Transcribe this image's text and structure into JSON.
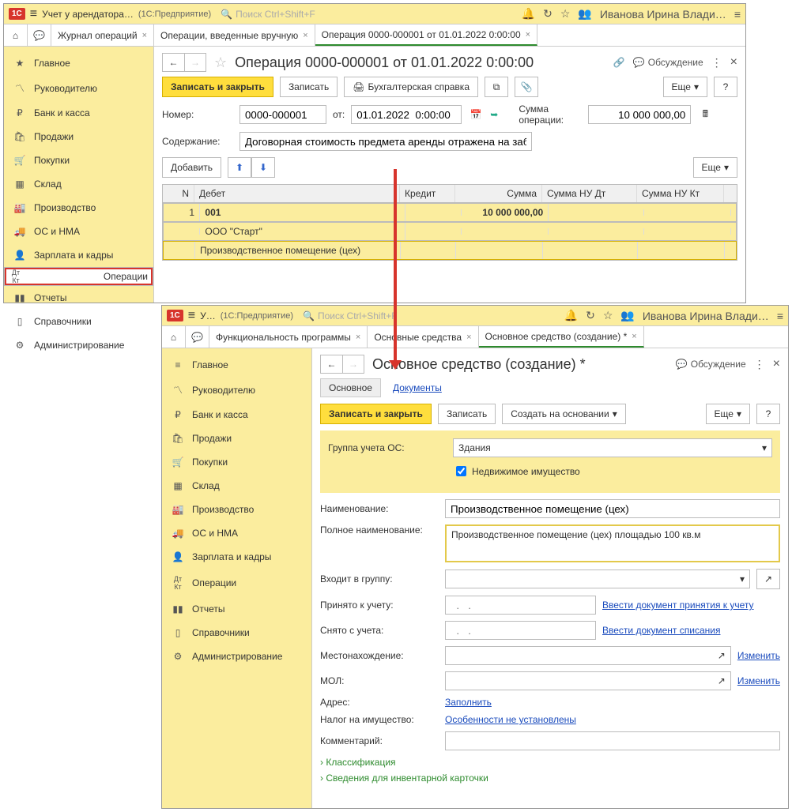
{
  "w1": {
    "title": "Учет у арендатора…",
    "subtitle": "(1С:Предприятие)",
    "search_ph": "Поиск Ctrl+Shift+F",
    "user": "Иванова Ирина Владимиров…",
    "tabs": [
      "Журнал операций",
      "Операции, введенные вручную",
      "Операция 0000-000001 от 01.01.2022 0:00:00"
    ],
    "sidebar": [
      "Главное",
      "Руководителю",
      "Банк и касса",
      "Продажи",
      "Покупки",
      "Склад",
      "Производство",
      "ОС и НМА",
      "Зарплата и кадры",
      "Операции",
      "Отчеты",
      "Справочники",
      "Администрирование"
    ],
    "page": {
      "title": "Операция 0000-000001 от 01.01.2022 0:00:00",
      "discuss": "Обсуждение",
      "save_close": "Записать и закрыть",
      "save": "Записать",
      "print": "Бухгалтерская справка",
      "more": "Еще",
      "num_lbl": "Номер:",
      "num": "0000-000001",
      "from_lbl": "от:",
      "from": "01.01.2022  0:00:00",
      "sum_lbl": "Сумма операции:",
      "sum": "10 000 000,00",
      "content_lbl": "Содержание:",
      "content": "Договорная стоимость предмета аренды отражена на заб",
      "add": "Добавить",
      "cols": {
        "n": "N",
        "db": "Дебет",
        "kr": "Кредит",
        "sm": "Сумма",
        "dt": "Сумма НУ Дт",
        "kt": "Сумма НУ Кт"
      },
      "row": {
        "n": "1",
        "db": "001",
        "r2": "ООО \"Старт\"",
        "r3": "Производственное помещение (цех)",
        "sm": "10 000 000,00"
      }
    }
  },
  "w2": {
    "title": "У…",
    "subtitle": "(1С:Предприятие)",
    "search_ph": "Поиск Ctrl+Shift+F",
    "user": "Иванова Ирина Владимир…",
    "tabs": [
      "Функциональность программы",
      "Основные средства",
      "Основное средство (создание) *"
    ],
    "sidebar": [
      "Главное",
      "Руководителю",
      "Банк и касса",
      "Продажи",
      "Покупки",
      "Склад",
      "Производство",
      "ОС и НМА",
      "Зарплата и кадры",
      "Операции",
      "Отчеты",
      "Справочники",
      "Администрирование"
    ],
    "page": {
      "title": "Основное средство (создание) *",
      "discuss": "Обсуждение",
      "sub_main": "Основное",
      "sub_docs": "Документы",
      "save_close": "Записать и закрыть",
      "save": "Записать",
      "create_based": "Создать на основании",
      "more": "Еще",
      "grp_lbl": "Группа учета ОС:",
      "grp_val": "Здания",
      "immov": "Недвижимое имущество",
      "name_lbl": "Наименование:",
      "name_val": "Производственное помещение (цех)",
      "fullname_lbl": "Полное наименование:",
      "fullname_val": "Производственное помещение (цех) площадью 100 кв.м",
      "ingroup_lbl": "Входит в группу:",
      "accepted_lbl": "Принято к учету:",
      "accepted_ph": "  .   .    ",
      "accepted_link": "Ввести документ принятия к учету",
      "removed_lbl": "Снято с учета:",
      "removed_ph": "  .   .    ",
      "removed_link": "Ввести документ списания",
      "location_lbl": "Местонахождение:",
      "change": "Изменить",
      "mol_lbl": "МОЛ:",
      "addr_lbl": "Адрес:",
      "addr_link": "Заполнить",
      "tax_lbl": "Налог на имущество:",
      "tax_link": "Особенности не установлены",
      "comment_lbl": "Комментарий:",
      "exp1": "Классификация",
      "exp2": "Сведения для инвентарной карточки"
    }
  }
}
